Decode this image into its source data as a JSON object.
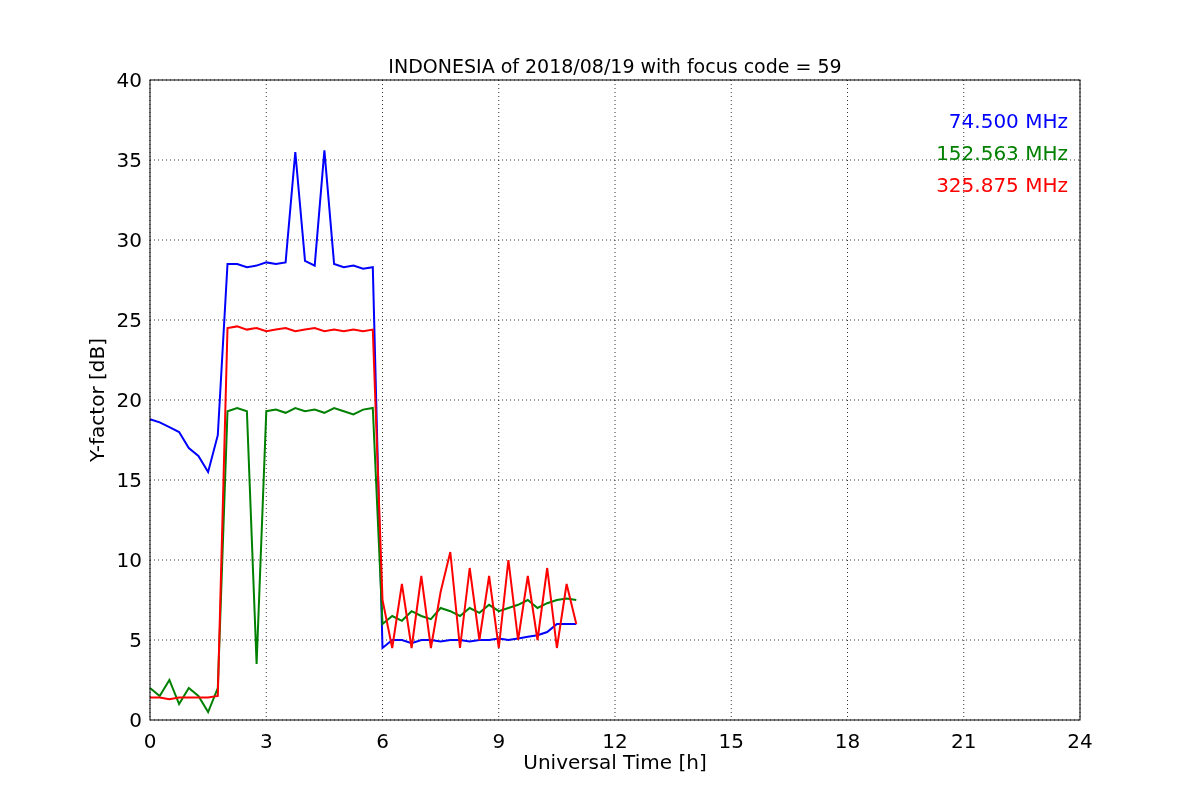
{
  "chart_data": {
    "type": "line",
    "title": "INDONESIA of 2018/08/19 with focus code = 59",
    "xlabel": "Universal Time [h]",
    "ylabel": "Y-factor [dB]",
    "x": [
      0,
      0.25,
      0.5,
      0.75,
      1,
      1.25,
      1.5,
      1.75,
      2,
      2.25,
      2.5,
      2.75,
      3,
      3.25,
      3.5,
      3.75,
      4,
      4.25,
      4.5,
      4.75,
      5,
      5.25,
      5.5,
      5.75,
      6,
      6.25,
      6.5,
      6.75,
      7,
      7.25,
      7.5,
      7.75,
      8,
      8.25,
      8.5,
      8.75,
      9,
      9.25,
      9.5,
      9.75,
      10,
      10.25,
      10.5,
      10.75,
      11
    ],
    "series": [
      {
        "name": "74.500 MHz",
        "color": "#0000ff",
        "values": [
          18.8,
          18.6,
          18.3,
          18,
          17,
          16.5,
          15.5,
          17.8,
          28.5,
          28.5,
          28.3,
          28.4,
          28.6,
          28.5,
          28.6,
          35.5,
          28.7,
          28.4,
          35.6,
          28.5,
          28.3,
          28.4,
          28.2,
          28.3,
          4.5,
          5,
          5,
          4.8,
          5,
          5,
          4.9,
          5,
          5,
          4.9,
          5,
          5,
          5.1,
          5,
          5.1,
          5.2,
          5.3,
          5.5,
          6,
          6,
          6
        ]
      },
      {
        "name": "152.563 MHz",
        "color": "#008000",
        "values": [
          2,
          1.5,
          2.5,
          1,
          2,
          1.5,
          0.5,
          2,
          19.3,
          19.5,
          19.3,
          3.5,
          19.3,
          19.4,
          19.2,
          19.5,
          19.3,
          19.4,
          19.2,
          19.5,
          19.3,
          19.1,
          19.4,
          19.5,
          6,
          6.5,
          6.2,
          6.8,
          6.5,
          6.3,
          7,
          6.8,
          6.5,
          7,
          6.7,
          7.2,
          6.8,
          7,
          7.2,
          7.5,
          7,
          7.3,
          7.5,
          7.6,
          7.5
        ]
      },
      {
        "name": "325.875 MHz",
        "color": "#ff0000",
        "values": [
          1.4,
          1.4,
          1.3,
          1.4,
          1.4,
          1.4,
          1.4,
          1.5,
          24.5,
          24.6,
          24.4,
          24.5,
          24.3,
          24.4,
          24.5,
          24.3,
          24.4,
          24.5,
          24.3,
          24.4,
          24.3,
          24.4,
          24.3,
          24.4,
          7.5,
          4.5,
          8.5,
          4.5,
          9,
          4.5,
          8,
          10.5,
          4.5,
          9.5,
          5,
          9,
          4.5,
          10,
          5,
          9,
          5,
          9.5,
          4.5,
          8.5,
          6
        ]
      }
    ],
    "xlim": [
      0,
      24
    ],
    "ylim": [
      0,
      40
    ],
    "xticks": [
      0,
      3,
      6,
      9,
      12,
      15,
      18,
      21,
      24
    ],
    "yticks": [
      0,
      5,
      10,
      15,
      20,
      25,
      30,
      35,
      40
    ],
    "grid": true
  }
}
